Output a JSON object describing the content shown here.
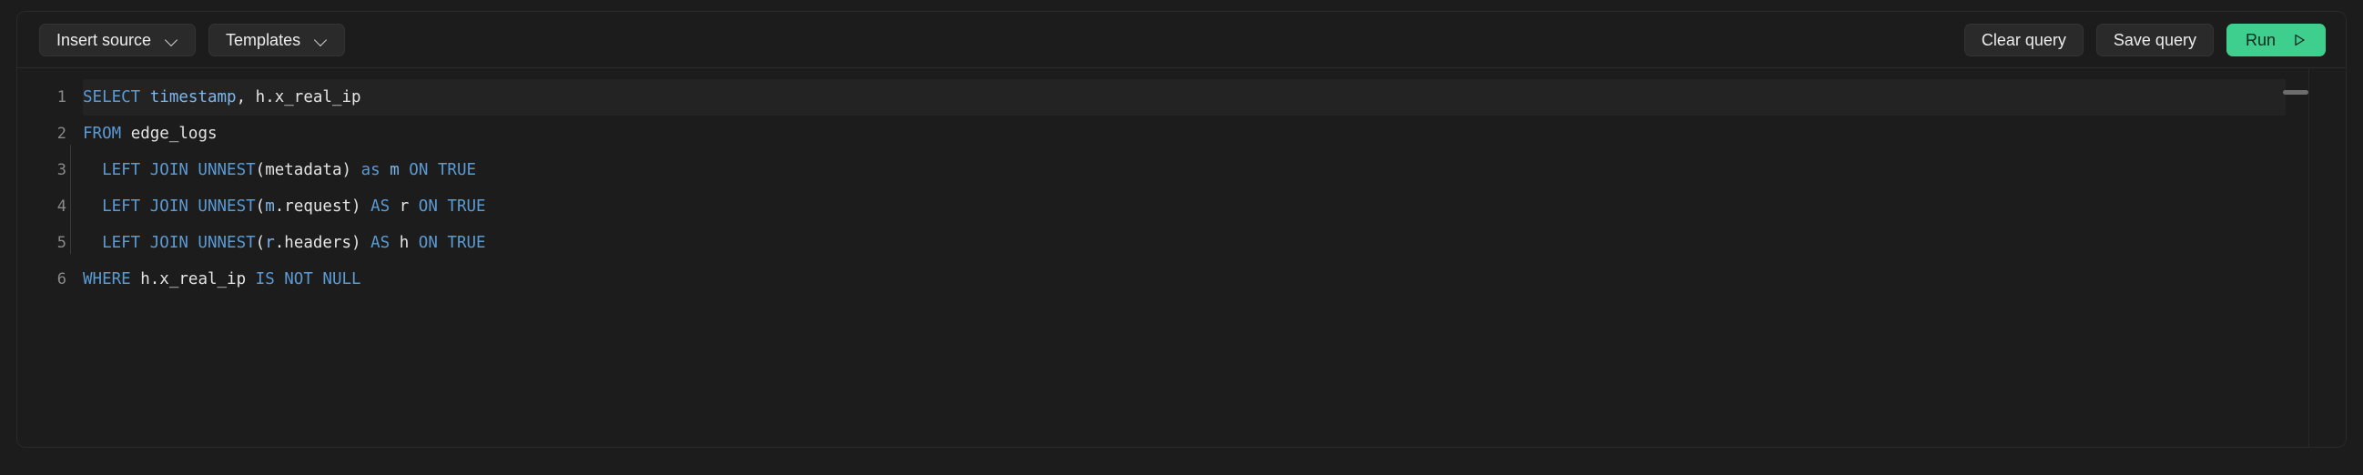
{
  "toolbar": {
    "left_buttons": [
      {
        "label": "Insert source",
        "icon": "chevron-down-icon"
      },
      {
        "label": "Templates",
        "icon": "chevron-down-icon"
      }
    ],
    "right_buttons": [
      {
        "label": "Clear query"
      },
      {
        "label": "Save query"
      }
    ],
    "run_button": {
      "label": "Run",
      "icon": "play-icon"
    }
  },
  "colors": {
    "background": "#1c1c1c",
    "button_bg": "#2a2a2a",
    "run_accent": "#3ecf8e",
    "keyword": "#5b9bd5",
    "identifier": "#7cb8ee",
    "text": "#e4e4e4",
    "line_number": "#8a8a8a"
  },
  "editor": {
    "lines": [
      {
        "number": "1",
        "indented": false,
        "tokens": [
          {
            "t": "SELECT",
            "c": "kw"
          },
          {
            "t": " ",
            "c": "txt"
          },
          {
            "t": "timestamp",
            "c": "id"
          },
          {
            "t": ", h.x_real_ip",
            "c": "txt"
          }
        ]
      },
      {
        "number": "2",
        "indented": false,
        "tokens": [
          {
            "t": "FROM",
            "c": "kw"
          },
          {
            "t": " edge_logs",
            "c": "txt"
          }
        ]
      },
      {
        "number": "3",
        "indented": true,
        "tokens": [
          {
            "t": "  ",
            "c": "txt"
          },
          {
            "t": "LEFT JOIN UNNEST",
            "c": "kw"
          },
          {
            "t": "(metadata) ",
            "c": "txt"
          },
          {
            "t": "as",
            "c": "kw"
          },
          {
            "t": " ",
            "c": "txt"
          },
          {
            "t": "m",
            "c": "id"
          },
          {
            "t": " ",
            "c": "txt"
          },
          {
            "t": "ON TRUE",
            "c": "kw"
          }
        ]
      },
      {
        "number": "4",
        "indented": true,
        "tokens": [
          {
            "t": "  ",
            "c": "txt"
          },
          {
            "t": "LEFT JOIN UNNEST",
            "c": "kw"
          },
          {
            "t": "(",
            "c": "txt"
          },
          {
            "t": "m",
            "c": "id"
          },
          {
            "t": ".request) ",
            "c": "txt"
          },
          {
            "t": "AS",
            "c": "kw"
          },
          {
            "t": " r ",
            "c": "txt"
          },
          {
            "t": "ON TRUE",
            "c": "kw"
          }
        ]
      },
      {
        "number": "5",
        "indented": true,
        "tokens": [
          {
            "t": "  ",
            "c": "txt"
          },
          {
            "t": "LEFT JOIN UNNEST",
            "c": "kw"
          },
          {
            "t": "(",
            "c": "txt"
          },
          {
            "t": "r",
            "c": "id"
          },
          {
            "t": ".headers) ",
            "c": "txt"
          },
          {
            "t": "AS",
            "c": "kw"
          },
          {
            "t": " h ",
            "c": "txt"
          },
          {
            "t": "ON TRUE",
            "c": "kw"
          }
        ]
      },
      {
        "number": "6",
        "indented": false,
        "tokens": [
          {
            "t": "WHERE",
            "c": "kw"
          },
          {
            "t": " h.x_real_ip ",
            "c": "txt"
          },
          {
            "t": "IS NOT NULL",
            "c": "kw"
          }
        ]
      }
    ]
  }
}
